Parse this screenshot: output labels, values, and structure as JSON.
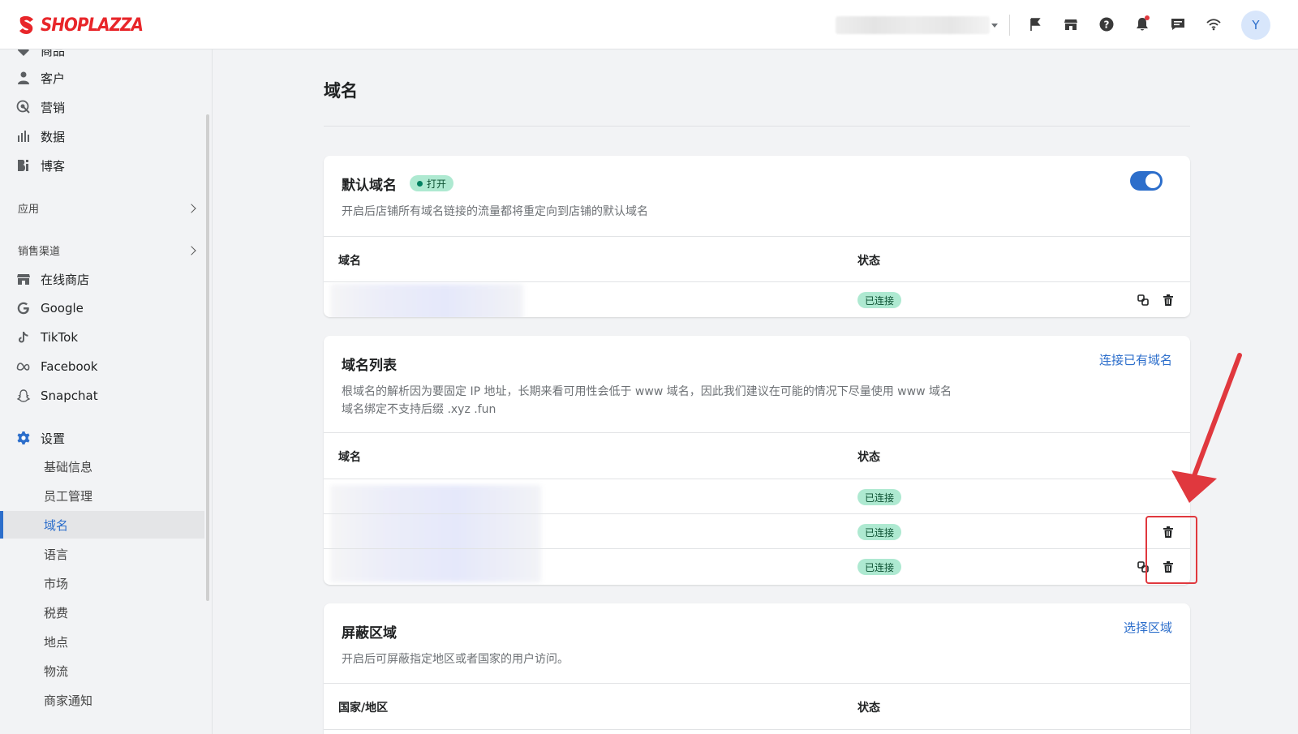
{
  "brand": {
    "name": "SHOPLAZZA",
    "color": "#e8262a"
  },
  "topbar": {
    "icons": [
      "flag-icon",
      "store-icon",
      "help-icon",
      "bell-icon",
      "chat-icon",
      "wifi-icon"
    ],
    "avatar_initial": "Y"
  },
  "sidebar": {
    "items": [
      {
        "label": "商品",
        "icon": "tag-icon"
      },
      {
        "label": "客户",
        "icon": "person-icon"
      },
      {
        "label": "营销",
        "icon": "target-icon"
      },
      {
        "label": "数据",
        "icon": "bar-chart-icon"
      },
      {
        "label": "博客",
        "icon": "blog-icon"
      }
    ],
    "apps_label": "应用",
    "channels_label": "销售渠道",
    "channels": [
      {
        "label": "在线商店",
        "icon": "store-icon"
      },
      {
        "label": "Google",
        "icon": "google-icon"
      },
      {
        "label": "TikTok",
        "icon": "tiktok-icon"
      },
      {
        "label": "Facebook",
        "icon": "meta-icon"
      },
      {
        "label": "Snapchat",
        "icon": "ghost-icon"
      }
    ],
    "settings_label": "设置",
    "settings_items": [
      "基础信息",
      "员工管理",
      "域名",
      "语言",
      "市场",
      "税费",
      "地点",
      "物流",
      "商家通知"
    ],
    "active_item": "域名",
    "accent": "#2c6ecb"
  },
  "page": {
    "title": "域名",
    "default_domain": {
      "title": "默认域名",
      "badge": "打开",
      "description": "开启后店铺所有域名链接的流量都将重定向到店铺的默认域名",
      "toggle_on": true,
      "col_domain": "域名",
      "col_status": "状态",
      "rows": [
        {
          "status": "已连接"
        }
      ]
    },
    "domain_list": {
      "title": "域名列表",
      "action": "连接已有域名",
      "description_line1": "根域名的解析因为要固定 IP 地址，长期来看可用性会低于 www 域名，因此我们建议在可能的情况下尽量使用 www 域名",
      "description_line2": "域名绑定不支持后缀 .xyz .fun",
      "col_domain": "域名",
      "col_status": "状态",
      "rows": [
        {
          "status": "已连接"
        },
        {
          "status": "已连接"
        },
        {
          "status": "已连接"
        }
      ]
    },
    "blocked_regions": {
      "title": "屏蔽区域",
      "action": "选择区域",
      "description": "开启后可屏蔽指定地区或者国家的用户访问。",
      "col_region": "国家/地区",
      "col_status": "状态"
    }
  },
  "annotation": {
    "color": "#e0383e"
  }
}
